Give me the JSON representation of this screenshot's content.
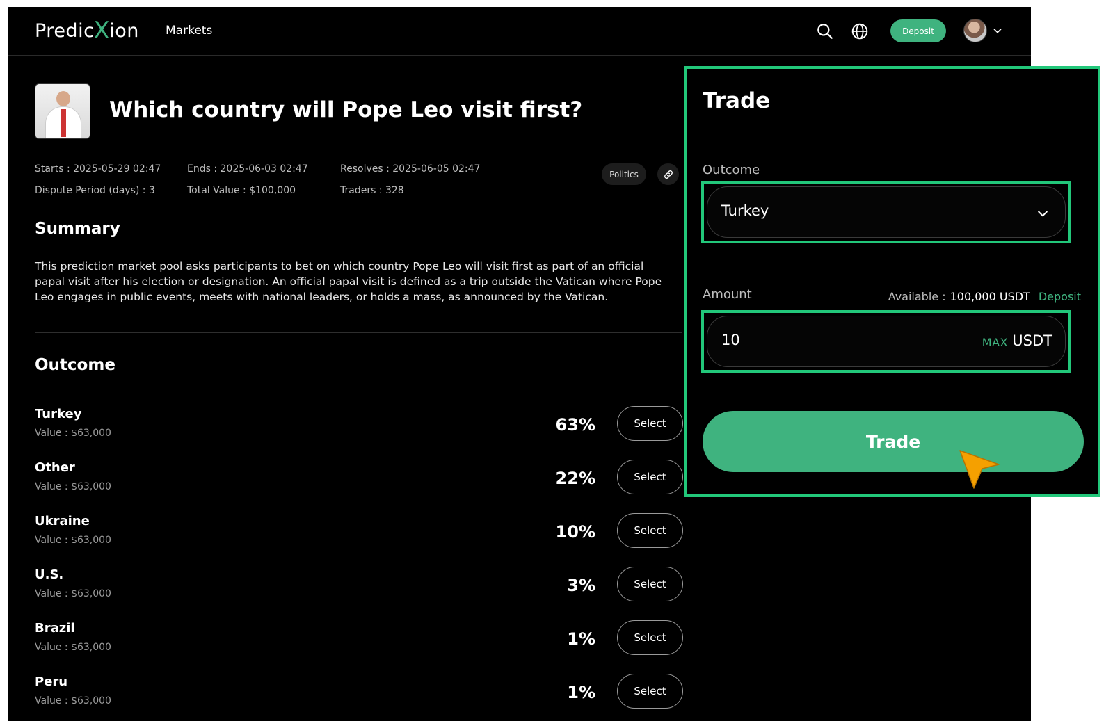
{
  "header": {
    "logo": {
      "pre": "Predic",
      "x": "X",
      "post": "ion"
    },
    "nav_markets": "Markets",
    "deposit_label": "Deposit",
    "icons": [
      "search-icon",
      "globe-icon",
      "avatar",
      "chevron-down-icon"
    ]
  },
  "market": {
    "title": "Which country will Pope Leo visit first?",
    "starts": "Starts : 2025-05-29  02:47",
    "ends": "Ends : 2025-06-03  02:47",
    "resolves": "Resolves : 2025-06-05  02:47",
    "dispute": "Dispute Period (days) : 3",
    "total_value": "Total Value : $100,000",
    "traders": "Traders : 328",
    "tag": "Politics",
    "link_icon": "link-icon"
  },
  "summary": {
    "heading": "Summary",
    "text": "This prediction market pool asks participants to bet on which country Pope Leo will visit first as part of an official papal visit after his election or designation. An official papal visit is defined as a trip outside the Vatican where Pope Leo engages in public events, meets with national leaders, or holds a mass, as announced by the Vatican."
  },
  "outcomes": {
    "heading": "Outcome",
    "select_label": "Select",
    "items": [
      {
        "name": "Turkey",
        "value": "Value : $63,000",
        "pct": "63%"
      },
      {
        "name": "Other",
        "value": "Value : $63,000",
        "pct": "22%"
      },
      {
        "name": "Ukraine",
        "value": "Value : $63,000",
        "pct": "10%"
      },
      {
        "name": "U.S.",
        "value": "Value : $63,000",
        "pct": "3%"
      },
      {
        "name": "Brazil",
        "value": "Value : $63,000",
        "pct": "1%"
      },
      {
        "name": "Peru",
        "value": "Value : $63,000",
        "pct": "1%"
      }
    ]
  },
  "trade": {
    "title": "Trade",
    "outcome_label": "Outcome",
    "selected_outcome": "Turkey",
    "amount_label": "Amount",
    "available_label": "Available :",
    "available_value": "100,000 USDT",
    "deposit_link": "Deposit",
    "amount_value": "10",
    "max_label": "MAX",
    "unit": "USDT",
    "button_label": "Trade"
  },
  "colors": {
    "accent": "#3fb37f",
    "highlight": "#22c77a",
    "background": "#000000",
    "cursor": "#f5a000"
  }
}
